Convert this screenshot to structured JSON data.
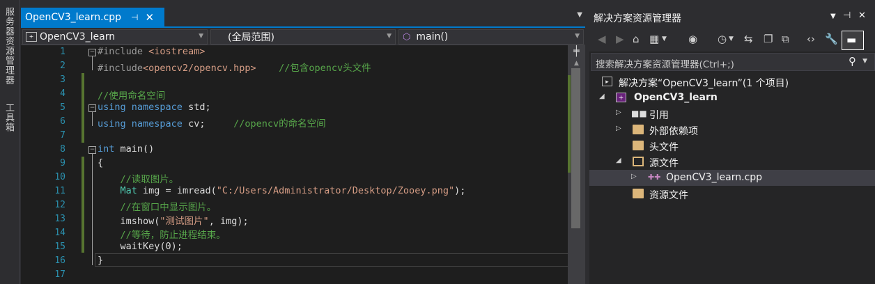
{
  "left_strip": {
    "server_explorer": "服务器资源管理器",
    "toolbox": "工具箱"
  },
  "editor": {
    "tab": {
      "title": "OpenCV3_learn.cpp",
      "pin": "⊣",
      "close": "✕"
    },
    "nav": {
      "project": "OpenCV3_learn",
      "scope": "(全局范围)",
      "member": "main()"
    },
    "lines": [
      {
        "n": "1"
      },
      {
        "n": "2"
      },
      {
        "n": "3"
      },
      {
        "n": "4"
      },
      {
        "n": "5"
      },
      {
        "n": "6"
      },
      {
        "n": "7"
      },
      {
        "n": "8"
      },
      {
        "n": "9"
      },
      {
        "n": "10"
      },
      {
        "n": "11"
      },
      {
        "n": "12"
      },
      {
        "n": "13"
      },
      {
        "n": "14"
      },
      {
        "n": "15"
      },
      {
        "n": "16"
      },
      {
        "n": "17"
      }
    ],
    "code": {
      "l1_a": "#include ",
      "l1_b": "<iostream>",
      "l2_a": "#include",
      "l2_b": "<opencv2/opencv.hpp>",
      "l2_c": "//包含opencv头文件",
      "l4": "//使用命名空间",
      "l5_a": "using",
      "l5_b": "namespace",
      "l5_c": "std;",
      "l6_a": "using",
      "l6_b": "namespace",
      "l6_c": "cv;",
      "l6_d": "//opencv的命名空间",
      "l8_a": "int",
      "l8_b": "main()",
      "l9": "{",
      "l10": "//读取图片。",
      "l11_a": "Mat",
      "l11_b": "img = imread(",
      "l11_c": "\"C:/Users/Administrator/Desktop/Zooey.png\"",
      "l11_d": ");",
      "l12": "//在窗口中显示图片。",
      "l13_a": "imshow(",
      "l13_b": "\"测试图片\"",
      "l13_c": ", img);",
      "l14": "//等待，防止进程结束。",
      "l15": "waitKey(0);",
      "l16": "}"
    }
  },
  "solution_explorer": {
    "title": "解决方案资源管理器",
    "search_placeholder": "搜索解决方案资源管理器(Ctrl+;)",
    "tree": {
      "solution": "解决方案“OpenCV3_learn”(1 个项目)",
      "project": "OpenCV3_learn",
      "references": "引用",
      "external": "外部依赖项",
      "headers": "头文件",
      "sources": "源文件",
      "cpp": "OpenCV3_learn.cpp",
      "resources": "资源文件"
    }
  },
  "colors": {
    "accent": "#007acc",
    "keyword": "#569cd6",
    "string": "#d69d85",
    "comment": "#57a64a",
    "type": "#4ec9b0",
    "line_number": "#2b91af"
  }
}
